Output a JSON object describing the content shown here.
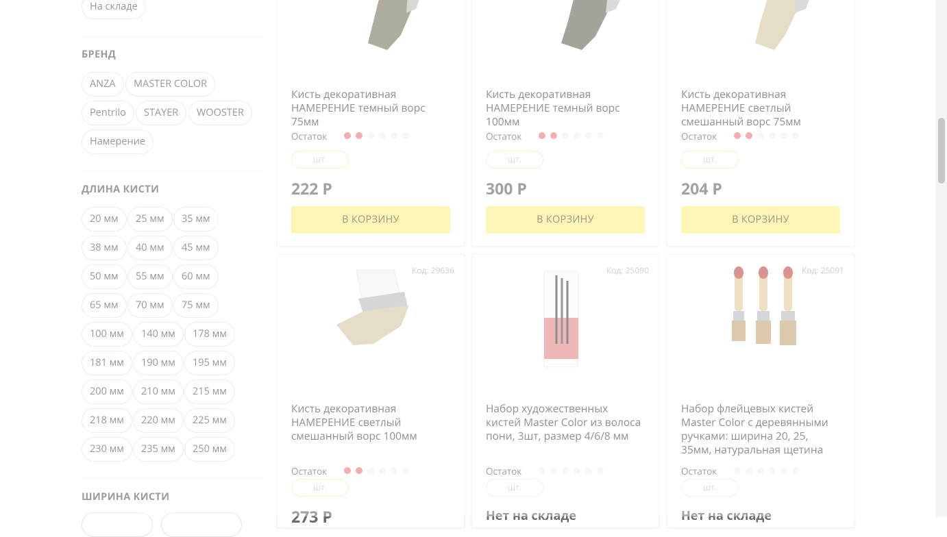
{
  "sidebar": {
    "availability": {
      "label": "На складе"
    },
    "brand": {
      "title": "БРЕНД",
      "items": [
        "ANZA",
        "MASTER COLOR",
        "Pentrilo",
        "STAYER",
        "WOOSTER",
        "Намерение"
      ]
    },
    "length": {
      "title": "ДЛИНА КИСТИ",
      "items": [
        "20 мм",
        "25 мм",
        "35 мм",
        "38 мм",
        "40 мм",
        "45 мм",
        "50 мм",
        "55 мм",
        "60 мм",
        "65 мм",
        "70 мм",
        "75 мм",
        "100 мм",
        "140 мм",
        "178 мм",
        "181 мм",
        "190 мм",
        "195 мм",
        "200 мм",
        "210 мм",
        "215 мм",
        "218 мм",
        "220 мм",
        "225 мм",
        "230 мм",
        "235 мм",
        "250 мм"
      ]
    },
    "width": {
      "title": "ШИРИНА КИСТИ"
    }
  },
  "common": {
    "stock_label": "Остаток",
    "qty_placeholder": "шт.",
    "buy_label": "В КОРЗИНУ",
    "out_of_stock": "Нет на складе"
  },
  "products": [
    {
      "name": "Кисть декоративная НАМЕРЕНИЕ темный ворс 75мм",
      "price": "222 Р",
      "stock_level": 2,
      "code": ""
    },
    {
      "name": "Кисть декоративная НАМЕРЕНИЕ темный ворс 100мм",
      "price": "300 Р",
      "stock_level": 2,
      "code": ""
    },
    {
      "name": "Кисть декоративная НАМЕРЕНИЕ светлый смешанный ворс 75мм",
      "price": "204 Р",
      "stock_level": 2,
      "code": ""
    },
    {
      "name": "Кисть декоративная НАМЕРЕНИЕ светлый смешанный ворс 100мм",
      "price": "273 Р",
      "stock_level": 2,
      "code": "Код: 29636"
    },
    {
      "name": "Набор художественных кистей Master Color из волоса пони, 3шт, размер 4/6/8 мм",
      "price": "",
      "stock_level": 0,
      "code": "Код: 25090"
    },
    {
      "name": "Набор флейцевых кистей Master Color с деревянными ручками: ширина 20, 25, 35мм, натуральная щетина",
      "price": "",
      "stock_level": 0,
      "code": "Код: 25091"
    }
  ]
}
